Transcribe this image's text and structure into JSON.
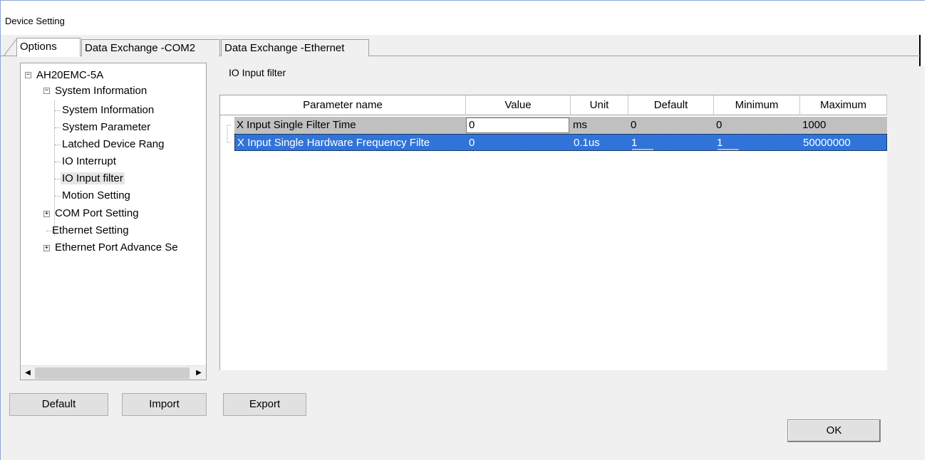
{
  "window": {
    "title": "Device Setting"
  },
  "tabs": [
    {
      "label": "Options",
      "active": true
    },
    {
      "label": "Data Exchange -COM2",
      "active": false
    },
    {
      "label": "Data Exchange -Ethernet",
      "active": false
    }
  ],
  "tree": {
    "root": "AH20EMC-5A",
    "system_information": "System Information",
    "children": [
      "System Information",
      "System Parameter",
      "Latched Device Rang",
      "IO Interrupt",
      "IO Input filter",
      "Motion Setting"
    ],
    "com_port": "COM Port Setting",
    "ethernet": "Ethernet Setting",
    "ethernet_adv": "Ethernet Port Advance Se",
    "selected": "IO Input filter"
  },
  "section": {
    "title": "IO Input filter"
  },
  "grid": {
    "columns": [
      "Parameter name",
      "Value",
      "Unit",
      "Default",
      "Minimum",
      "Maximum"
    ],
    "rows": [
      {
        "name": "X Input Single Filter Time",
        "value": "0",
        "unit": "ms",
        "default": "0",
        "minimum": "0",
        "maximum": "1000"
      },
      {
        "name": "X Input Single Hardware Frequency Filte",
        "value": "0",
        "unit": "0.1us",
        "default": "1",
        "minimum": "1",
        "maximum": "50000000"
      }
    ]
  },
  "buttons": {
    "default": "Default",
    "import": "Import",
    "export": "Export",
    "ok": "OK"
  },
  "colors": {
    "selection": "#3074d9",
    "row_gray": "#c0c0c0",
    "face": "#f0f0f0"
  }
}
